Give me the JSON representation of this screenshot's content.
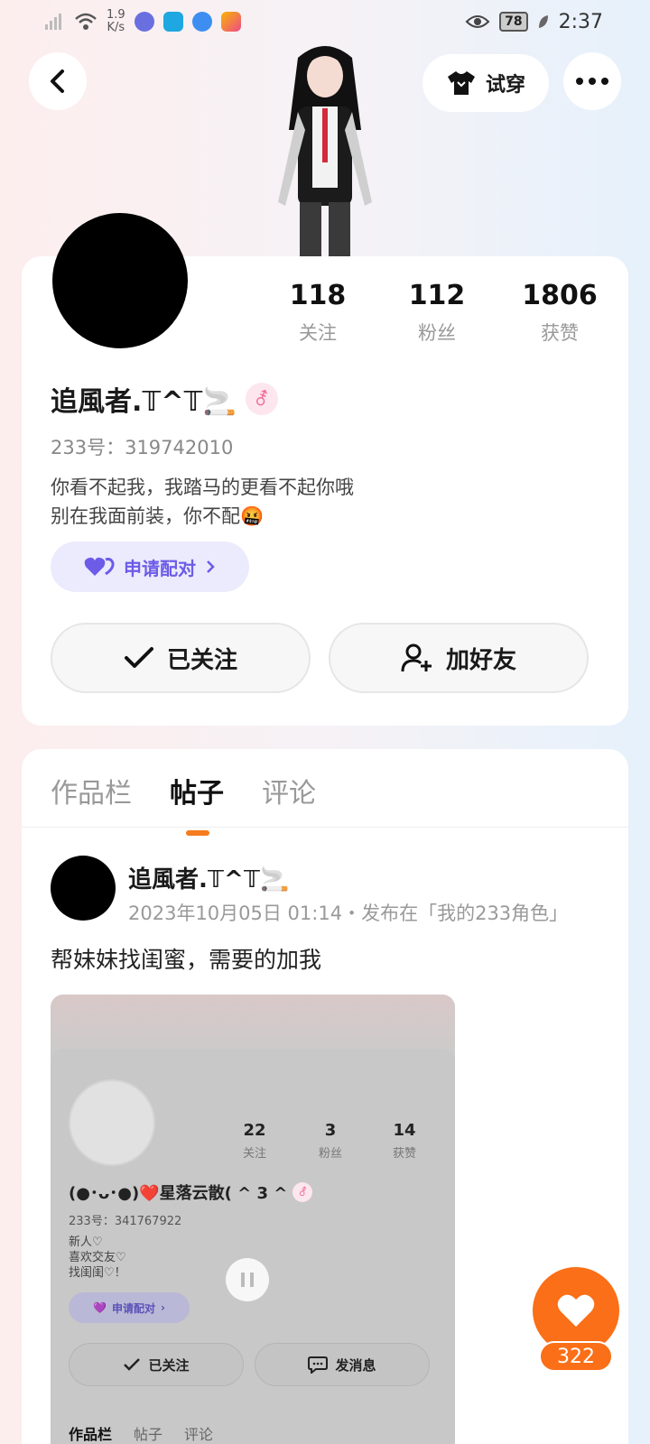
{
  "status_bar": {
    "network_speed": "1.9\nK/s",
    "battery": "78",
    "time": "2:37"
  },
  "header": {
    "tryon_label": "试穿"
  },
  "profile": {
    "stats": [
      {
        "value": "118",
        "label": "关注"
      },
      {
        "value": "112",
        "label": "粉丝"
      },
      {
        "value": "1806",
        "label": "获赞"
      }
    ],
    "nickname": "追風者.𝕋^𝕋🚬",
    "gender_symbol": "⚦",
    "user_id": "233号：319742010",
    "bio_line1": "你看不起我，我踏马的更看不起你哦",
    "bio_line2": "别在我面前装，你不配🤬",
    "pair_label": "申请配对",
    "followed_label": "已关注",
    "add_friend_label": "加好友"
  },
  "tabs": [
    {
      "label": "作品栏"
    },
    {
      "label": "帖子"
    },
    {
      "label": "评论"
    }
  ],
  "post": {
    "author": "追風者.𝕋^𝕋🚬",
    "meta": "2023年10月05日 01:14・发布在「我的233角色」",
    "text": "帮妹妹找闺蜜，需要的加我",
    "image": {
      "stats": [
        {
          "value": "22",
          "label": "关注"
        },
        {
          "value": "3",
          "label": "粉丝"
        },
        {
          "value": "14",
          "label": "获赞"
        }
      ],
      "name": "(●･ᴗ･●)❤️星落云散( ^ 3 ^",
      "user_id": "233号：341767922",
      "bio_lines": [
        "新人♡",
        "喜欢交友♡",
        "找闺闺♡！"
      ],
      "pair_label": "申请配对",
      "followed_label": "已关注",
      "message_label": "发消息",
      "tabs": [
        "作品栏",
        "帖子",
        "评论"
      ]
    }
  },
  "like": {
    "count": "322"
  },
  "colors": {
    "accent": "#fa6f17",
    "pair": "#6c5ce7"
  }
}
